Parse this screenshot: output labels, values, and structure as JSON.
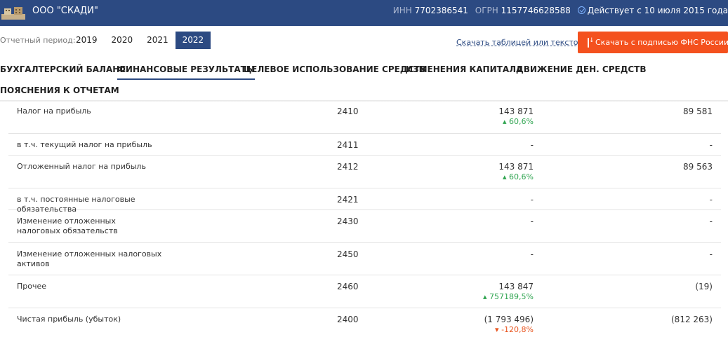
{
  "header": {
    "company": "ООО \"СКАДИ\"",
    "inn_label": "ИНН",
    "inn": "7702386541",
    "ogrn_label": "ОГРН",
    "ogrn": "1157746628588",
    "status": "Действует с 10 июля 2015 года"
  },
  "period": {
    "label": "Отчетный период:",
    "years": [
      "2019",
      "2020",
      "2021",
      "2022"
    ],
    "selected": "2022"
  },
  "downloads": {
    "link": "Скачать таблицей или текстом",
    "button": "Скачать с подписью ФНС России"
  },
  "tabs": [
    "БУХГАЛТЕРСКИЙ БАЛАНС",
    "ФИНАНСОВЫЕ РЕЗУЛЬТАТЫ",
    "ЦЕЛЕВОЕ ИСПОЛЬЗОВАНИЕ СРЕДСТВ",
    "ИЗМЕНЕНИЯ КАПИТАЛА",
    "ДВИЖЕНИЕ ДЕН. СРЕДСТВ",
    "ПОЯСНЕНИЯ К ОТЧЕТАМ"
  ],
  "active_tab": "ФИНАНСОВЫЕ РЕЗУЛЬТАТЫ",
  "rows": [
    {
      "name": "Налог на прибыль",
      "code": "2410",
      "v1": "143 871",
      "delta": "60,6%",
      "delta_dir": "up",
      "v2": "89 581"
    },
    {
      "name": "в т.ч. текущий налог на прибыль",
      "code": "2411",
      "v1": "-",
      "delta": "",
      "delta_dir": "",
      "v2": "-"
    },
    {
      "name": "Отложенный налог на прибыль",
      "code": "2412",
      "v1": "143 871",
      "delta": "60,6%",
      "delta_dir": "up",
      "v2": "89 563"
    },
    {
      "name": "в т.ч. постоянные налоговые обязательства",
      "code": "2421",
      "v1": "-",
      "delta": "",
      "delta_dir": "",
      "v2": "-"
    },
    {
      "name": "Изменение отложенных налоговых обязательств",
      "code": "2430",
      "v1": "-",
      "delta": "",
      "delta_dir": "",
      "v2": "-"
    },
    {
      "name": "Изменение отложенных налоговых активов",
      "code": "2450",
      "v1": "-",
      "delta": "",
      "delta_dir": "",
      "v2": "-"
    },
    {
      "name": "Прочее",
      "code": "2460",
      "v1": "143 847",
      "delta": "757189,5%",
      "delta_dir": "up",
      "v2": "(19)"
    },
    {
      "name": "Чистая прибыль (убыток)",
      "code": "2400",
      "v1": "(1 793 496)",
      "delta": "-120,8%",
      "delta_dir": "down",
      "v2": "(812 263)"
    }
  ],
  "colors": {
    "brand": "#2c4a82",
    "accent": "#f4511e",
    "up": "#2ea44f",
    "down": "#e8541e"
  }
}
